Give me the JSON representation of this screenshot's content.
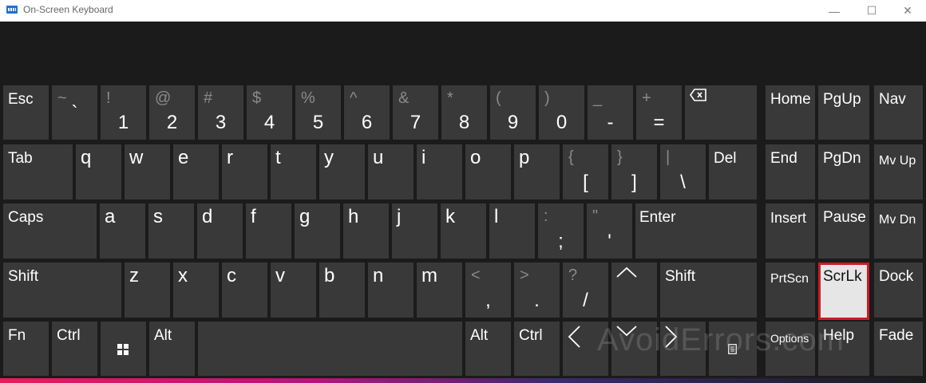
{
  "window": {
    "title": "On-Screen Keyboard",
    "minimize_glyph": "—",
    "maximize_glyph": "☐",
    "close_glyph": "✕"
  },
  "watermark": "AvoidErrors.com",
  "colors": {
    "key_bg": "#393939",
    "panel_bg": "#1b1b1b",
    "active_key_bg": "#e6e6e6",
    "active_key_border": "#d01a22"
  },
  "row1": {
    "esc": "Esc",
    "k1": {
      "shift": "~",
      "main": "`"
    },
    "k2": {
      "shift": "!",
      "main": "1"
    },
    "k3": {
      "shift": "@",
      "main": "2"
    },
    "k4": {
      "shift": "#",
      "main": "3"
    },
    "k5": {
      "shift": "$",
      "main": "4"
    },
    "k6": {
      "shift": "%",
      "main": "5"
    },
    "k7": {
      "shift": "^",
      "main": "6"
    },
    "k8": {
      "shift": "&",
      "main": "7"
    },
    "k9": {
      "shift": "*",
      "main": "8"
    },
    "k10": {
      "shift": "(",
      "main": "9"
    },
    "k11": {
      "shift": ")",
      "main": "0"
    },
    "k12": {
      "shift": "_",
      "main": "-"
    },
    "k13": {
      "shift": "+",
      "main": "="
    },
    "backspace_icon": "backspace-icon"
  },
  "row2": {
    "tab": "Tab",
    "letters": [
      "q",
      "w",
      "e",
      "r",
      "t",
      "y",
      "u",
      "i",
      "o",
      "p"
    ],
    "lbracket": {
      "shift": "{",
      "main": "["
    },
    "rbracket": {
      "shift": "}",
      "main": "]"
    },
    "backslash": {
      "shift": "|",
      "main": "\\"
    },
    "del": "Del"
  },
  "row3": {
    "caps": "Caps",
    "letters": [
      "a",
      "s",
      "d",
      "f",
      "g",
      "h",
      "j",
      "k",
      "l"
    ],
    "semicolon": {
      "shift": ":",
      "main": ";"
    },
    "quote": {
      "shift": "\"",
      "main": "'"
    },
    "enter": "Enter"
  },
  "row4": {
    "shift_left": "Shift",
    "letters": [
      "z",
      "x",
      "c",
      "v",
      "b",
      "n",
      "m"
    ],
    "comma": {
      "shift": "<",
      "main": ","
    },
    "period": {
      "shift": ">",
      "main": "."
    },
    "slash": {
      "shift": "?",
      "main": "/"
    },
    "shift_right": "Shift"
  },
  "row5": {
    "fn": "Fn",
    "ctrl_left": "Ctrl",
    "alt_left": "Alt",
    "alt_right": "Alt",
    "ctrl_right": "Ctrl"
  },
  "nav": {
    "home": "Home",
    "pgup": "PgUp",
    "nav": "Nav",
    "end": "End",
    "pgdn": "PgDn",
    "mvup": "Mv Up",
    "insert": "Insert",
    "pause": "Pause",
    "mvdn": "Mv Dn",
    "prtscn": "PrtScn",
    "scrlk": "ScrLk",
    "dock": "Dock",
    "options": "Options",
    "help": "Help",
    "fade": "Fade"
  }
}
